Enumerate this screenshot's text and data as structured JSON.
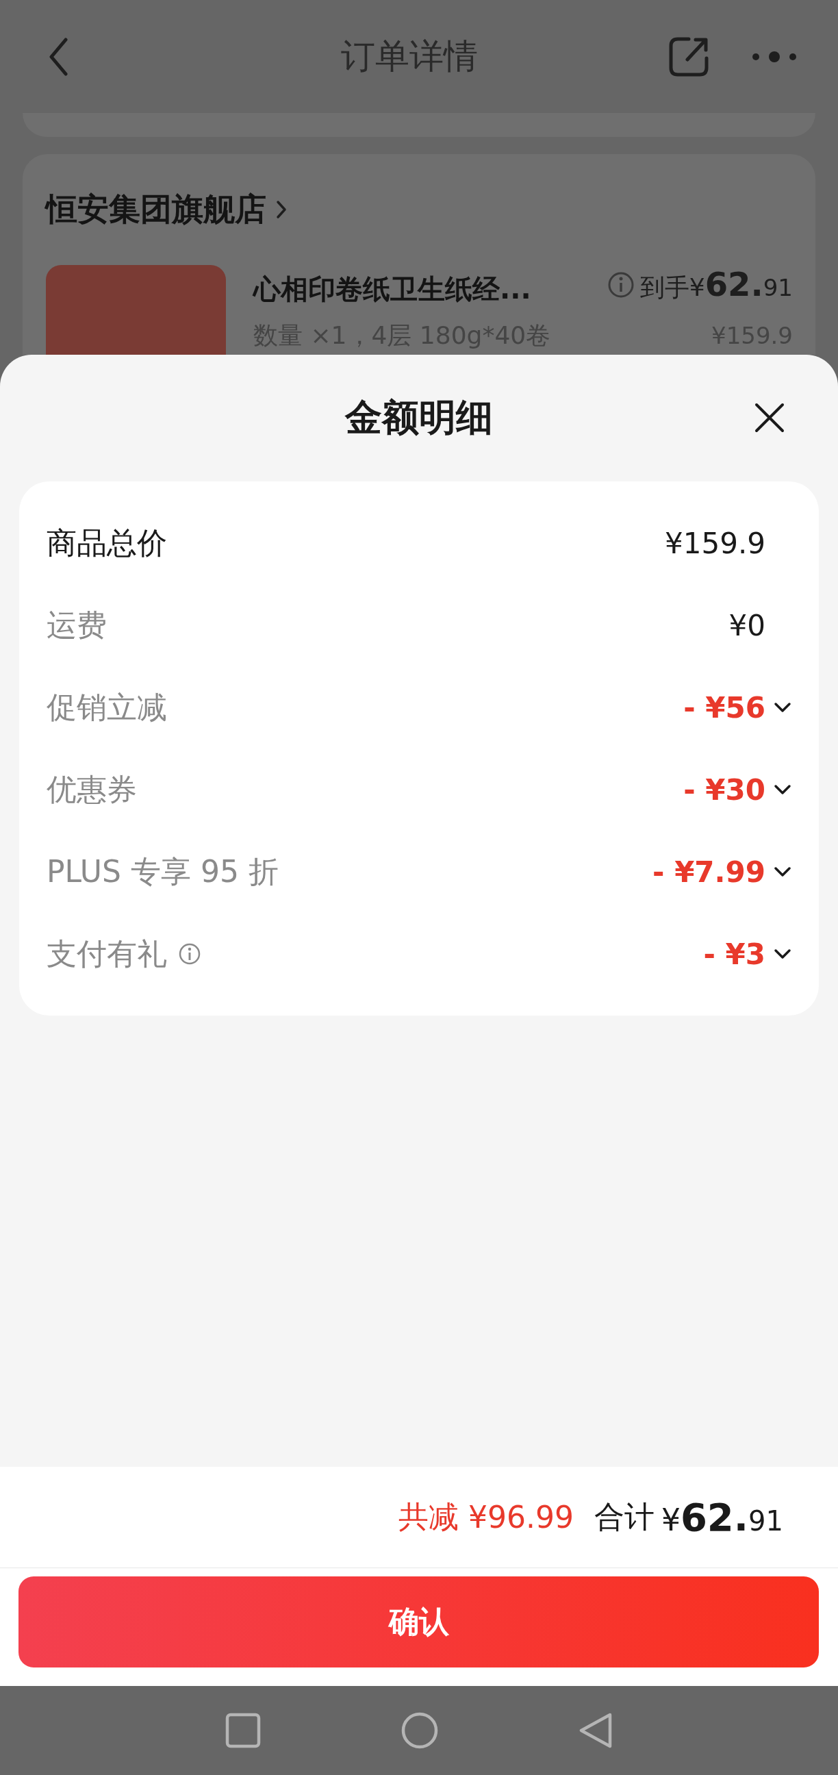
{
  "header": {
    "title": "订单详情"
  },
  "store": {
    "name": "恒安集团旗舰店"
  },
  "product": {
    "title": "心相印卷纸卫生纸经...",
    "price_prefix": "到手¥",
    "price_integer": "62.",
    "price_decimal": "91",
    "spec": "数量 ×1，4层 180g*40卷",
    "original_price": "¥159.9"
  },
  "sheet": {
    "title": "金额明细",
    "rows": [
      {
        "label": "商品总价",
        "value": "¥159.9",
        "kind": "total",
        "info": false,
        "expandable": false
      },
      {
        "label": "运费",
        "value": "¥0",
        "kind": "fee",
        "info": false,
        "expandable": false
      },
      {
        "label": "促销立减",
        "value": "- ¥56",
        "kind": "discount",
        "info": false,
        "expandable": true
      },
      {
        "label": "优惠券",
        "value": "- ¥30",
        "kind": "discount",
        "info": false,
        "expandable": true
      },
      {
        "label": "PLUS 专享 95 折",
        "value": "- ¥7.99",
        "kind": "discount",
        "info": false,
        "expandable": true
      },
      {
        "label": "支付有礼",
        "value": "- ¥3",
        "kind": "discount",
        "info": true,
        "expandable": true
      }
    ]
  },
  "summary": {
    "saved_label": "共减",
    "saved_value": "¥96.99",
    "total_label": "合计",
    "total_prefix": "¥",
    "total_integer": "62.",
    "total_decimal": "91"
  },
  "confirm_button": {
    "label": "确认"
  }
}
